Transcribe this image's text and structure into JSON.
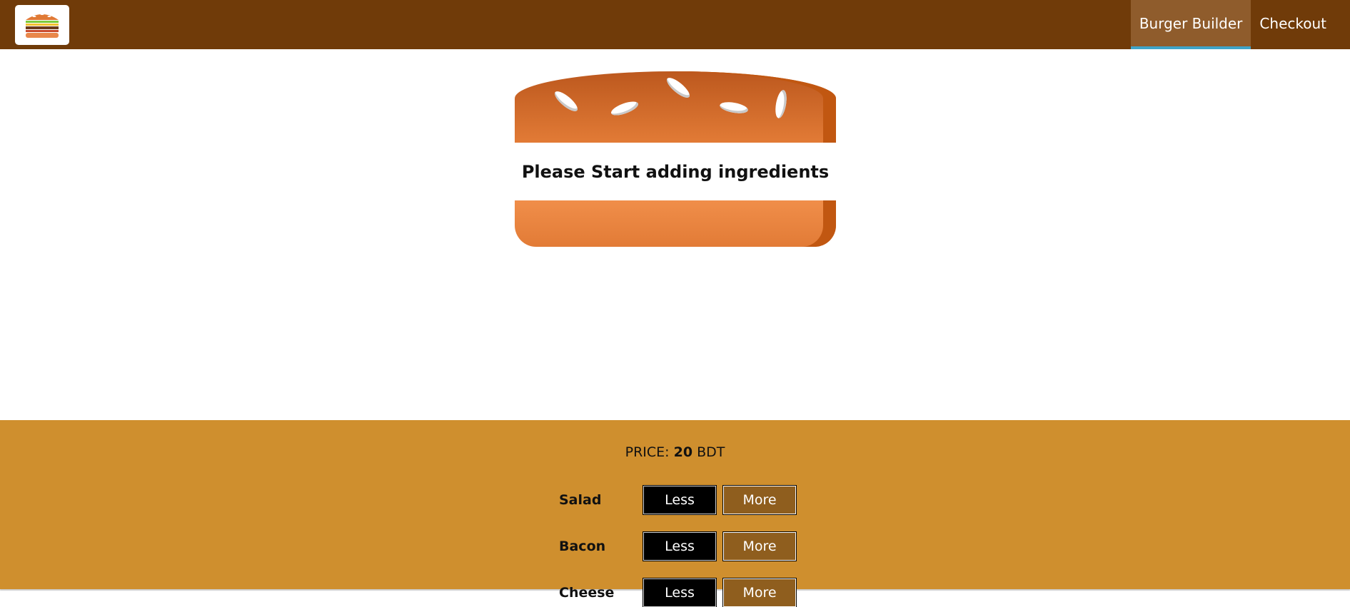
{
  "toolbar": {
    "logo_icon": "burger-logo-icon",
    "nav": [
      {
        "label": "Burger Builder",
        "active": true
      },
      {
        "label": "Checkout",
        "active": false
      }
    ]
  },
  "burger": {
    "message": "Please Start adding ingredients"
  },
  "controls": {
    "price_prefix": "PRICE:",
    "price_value": "20",
    "price_currency": "BDT",
    "ingredients": [
      {
        "label": "Salad",
        "less": "Less",
        "more": "More"
      },
      {
        "label": "Bacon",
        "less": "Less",
        "more": "More"
      },
      {
        "label": "Cheese",
        "less": "Less",
        "more": "More"
      }
    ]
  },
  "colors": {
    "toolbar_bg": "#703b09",
    "active_tab_bg": "#8f5c2c",
    "active_tab_underline": "#40a4c8",
    "controls_bg": "#cf8f2e",
    "more_button_bg": "#8f5e1e"
  }
}
